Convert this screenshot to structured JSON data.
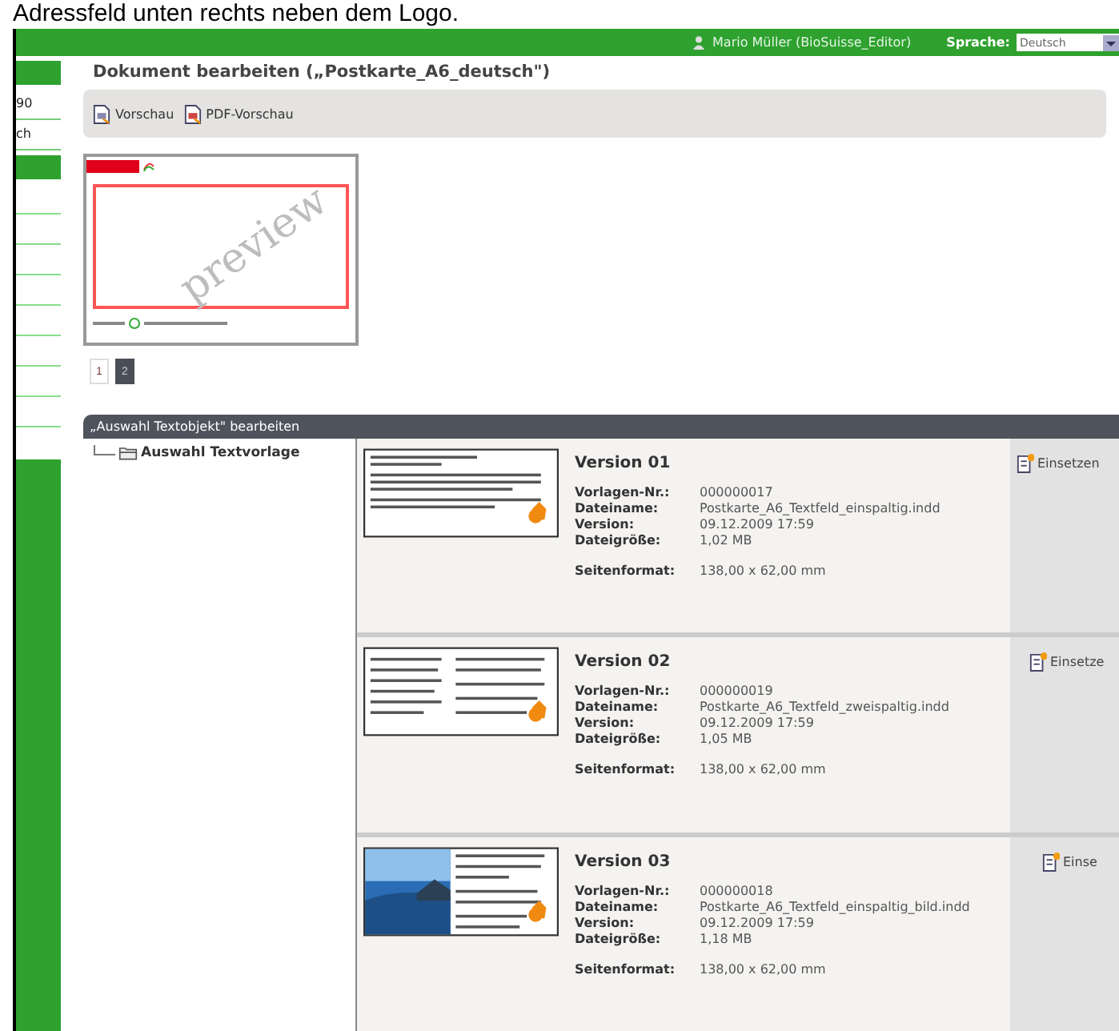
{
  "caption": "Adressfeld unten rechts neben dem Logo.",
  "topbar": {
    "user": "Mario Müller (BioSuisse_Editor)",
    "language_label": "Sprache:",
    "language_value": "Deutsch"
  },
  "sidebar": {
    "items": [
      {
        "label": "90",
        "selected": false
      },
      {
        "label": "ch",
        "selected": false
      }
    ]
  },
  "title": "Dokument bearbeiten („Postkarte_A6_deutsch\")",
  "toolbar": [
    {
      "label": "Vorschau"
    },
    {
      "label": "PDF-Vorschau"
    }
  ],
  "preview": {
    "watermark": "preview"
  },
  "pages": [
    {
      "label": "1",
      "selected": false
    },
    {
      "label": "2",
      "selected": true
    }
  ],
  "section": {
    "title": "„Auswahl Textobjekt\" bearbeiten",
    "tree": {
      "label": "Auswahl Textvorlage",
      "expanded": true
    }
  },
  "versions": [
    {
      "title": "Version 01",
      "kind": "text",
      "fields": [
        {
          "label": "Vorlagen-Nr.:",
          "value": "000000017"
        },
        {
          "label": "Dateiname:",
          "value": "Postkarte_A6_Textfeld_einspaltig.indd"
        },
        {
          "label": "Version:",
          "value": "09.12.2009 17:59"
        },
        {
          "label": "Dateigröße:",
          "value": "1,02 MB"
        }
      ],
      "format_label": "Seitenformat:",
      "format": "138,00 x 62,00 mm",
      "action": "Einsetzen"
    },
    {
      "title": "Version 02",
      "kind": "columns",
      "fields": [
        {
          "label": "Vorlagen-Nr.:",
          "value": "000000019"
        },
        {
          "label": "Dateiname:",
          "value": "Postkarte_A6_Textfeld_zweispaltig.indd"
        },
        {
          "label": "Version:",
          "value": "09.12.2009 17:59"
        },
        {
          "label": "Dateigröße:",
          "value": "1,05 MB"
        }
      ],
      "format_label": "Seitenformat:",
      "format": "138,00 x 62,00 mm",
      "action": "Einsetze"
    },
    {
      "title": "Version 03",
      "kind": "photo",
      "fields": [
        {
          "label": "Vorlagen-Nr.:",
          "value": "000000018"
        },
        {
          "label": "Dateiname:",
          "value": "Postkarte_A6_Textfeld_einspaltig_bild.indd"
        },
        {
          "label": "Version:",
          "value": "09.12.2009 17:59"
        },
        {
          "label": "Dateigröße:",
          "value": "1,18 MB"
        }
      ],
      "format_label": "Seitenformat:",
      "format": "138,00 x 62,00 mm",
      "action": "Einse"
    }
  ]
}
